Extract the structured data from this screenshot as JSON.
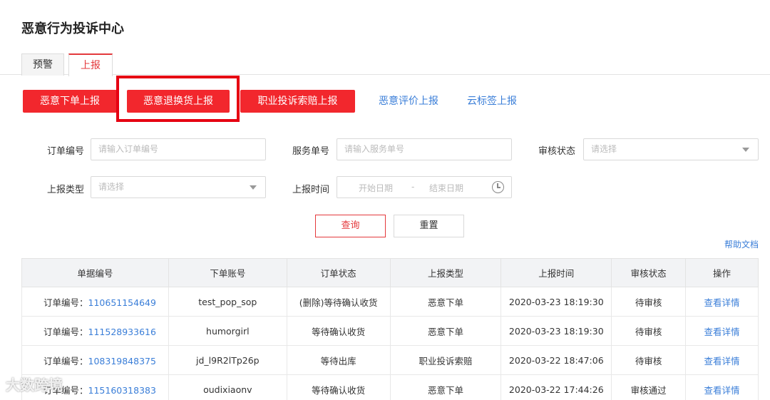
{
  "page_title": "恶意行为投诉中心",
  "tabs": [
    {
      "label": "预警",
      "active": false
    },
    {
      "label": "上报",
      "active": true
    }
  ],
  "action_buttons": {
    "malicious_order": "恶意下单上报",
    "malicious_return": "恶意退换货上报",
    "professional_claim": "职业投诉索赔上报",
    "malicious_review": "恶意评价上报",
    "cloud_tag": "云标签上报"
  },
  "filters": {
    "order_no": {
      "label": "订单编号",
      "placeholder": "请输入订单编号"
    },
    "service_no": {
      "label": "服务单号",
      "placeholder": "请输入服务单号"
    },
    "review_status": {
      "label": "审核状态",
      "placeholder": "请选择"
    },
    "report_type": {
      "label": "上报类型",
      "placeholder": "请选择"
    },
    "report_time": {
      "label": "上报时间",
      "start": "开始日期",
      "sep": "-",
      "end": "结束日期"
    }
  },
  "buttons": {
    "query": "查询",
    "reset": "重置"
  },
  "help_link": "帮助文档",
  "table": {
    "headers": [
      "单据编号",
      "下单账号",
      "订单状态",
      "上报类型",
      "上报时间",
      "审核状态",
      "操作"
    ],
    "order_prefix": "订单编号：",
    "rows": [
      {
        "order_no": "110651154649",
        "account": "test_pop_sop",
        "order_status": "(删除)等待确认收货",
        "report_type": "恶意下单",
        "report_time": "2020-03-23 18:19:30",
        "review_status": "待审核",
        "action": "查看详情"
      },
      {
        "order_no": "111528933616",
        "account": "humorgirl",
        "order_status": "等待确认收货",
        "report_type": "恶意下单",
        "report_time": "2020-03-23 18:19:30",
        "review_status": "待审核",
        "action": "查看详情"
      },
      {
        "order_no": "108319848375",
        "account": "jd_l9R2lTp26p",
        "order_status": "等待出库",
        "report_type": "职业投诉索赔",
        "report_time": "2020-03-22 18:47:06",
        "review_status": "待审核",
        "action": "查看详情"
      },
      {
        "order_no": "115160318383",
        "account": "oudixiaonv",
        "order_status": "等待确认收货",
        "report_type": "恶意下单",
        "report_time": "2020-03-22 17:44:26",
        "review_status": "审核通过",
        "action": "查看详情"
      }
    ]
  },
  "watermark": "大数跨境",
  "colors": {
    "accent_red": "#f2272d",
    "link_blue": "#3a7ed8",
    "highlight_red": "#e60012"
  }
}
